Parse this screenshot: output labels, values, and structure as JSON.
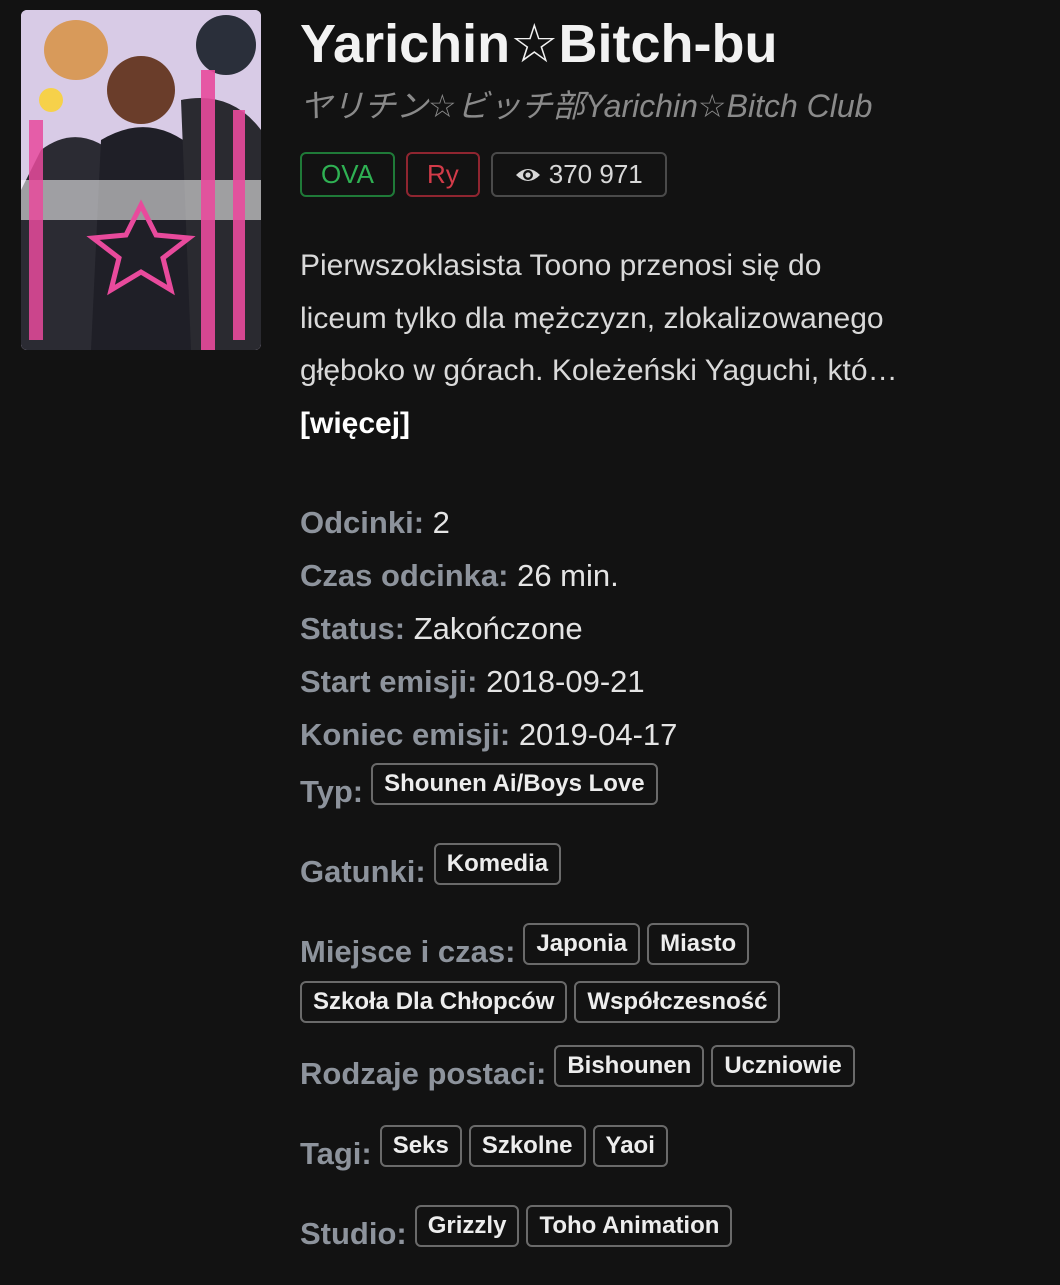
{
  "cover": {
    "alt": "Yarichin Bitch-bu cover"
  },
  "title": "Yarichin☆Bitch-bu",
  "alt_title": "ヤリチン☆ビッチ部Yarichin☆Bitch Club",
  "badges": {
    "type": "OVA",
    "rating": "Ry",
    "views": "370 971"
  },
  "description": {
    "line1": "Pierwszoklasista Toono przenosi się do",
    "line2": "liceum tylko dla mężczyzn, zlokalizowanego",
    "line3": "głęboko w górach. Koleżeński Yaguchi, któ…",
    "more": "[więcej]"
  },
  "meta": {
    "episodes_label": "Odcinki:",
    "episodes": "2",
    "duration_label": "Czas odcinka:",
    "duration": "26 min.",
    "status_label": "Status:",
    "status": "Zakończone",
    "start_label": "Start emisji:",
    "start": "2018-09-21",
    "end_label": "Koniec emisji:",
    "end": "2019-04-17"
  },
  "tags": {
    "type_label": "Typ:",
    "type": [
      "Shounen Ai/Boys Love"
    ],
    "genres_label": "Gatunki:",
    "genres": [
      "Komedia"
    ],
    "place_label": "Miejsce i czas:",
    "place": [
      "Japonia",
      "Miasto",
      "Szkoła Dla Chłopców",
      "Współczesność"
    ],
    "chars_label": "Rodzaje postaci:",
    "chars": [
      "Bishounen",
      "Uczniowie"
    ],
    "tags_label": "Tagi:",
    "tags": [
      "Seks",
      "Szkolne",
      "Yaoi"
    ],
    "studio_label": "Studio:",
    "studio": [
      "Grizzly",
      "Toho Animation"
    ]
  },
  "colors": {
    "background": "#121212",
    "ova": "#2fb153",
    "rating": "#d33b49",
    "label": "#8d939c"
  }
}
